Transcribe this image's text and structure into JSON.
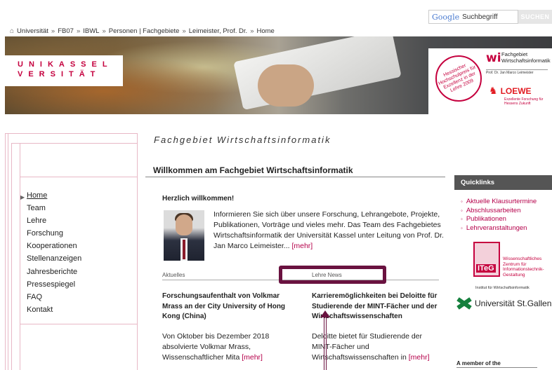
{
  "search": {
    "logo": "Google",
    "placeholder": "Suchbegriff",
    "button": "SUCHEN"
  },
  "breadcrumb": [
    "Universität",
    "FB07",
    "IBWL",
    "Personen | Fachgebiete",
    "Leimeister, Prof. Dr.",
    "Home"
  ],
  "breadcrumb_separator": "»",
  "banner": {
    "uni_line1": "UNIKASSEL",
    "uni_line2": "VERSITÄT",
    "seal_text": "Hessischer Hochschulpreis für Exzellenz in der Lehre 2009",
    "wi_mark": "wi",
    "wi_title": "Fachgebiet\nWirtschaftsinformatik",
    "wi_prof": "Prof. Dr. Jan Marco Leimeister",
    "loewe": "LOEWE",
    "loewe_sub": "Exzellente Forschung für\nHessens Zukunft"
  },
  "nav": {
    "items": [
      "Home",
      "Team",
      "Lehre",
      "Forschung",
      "Kooperationen",
      "Stellenanzeigen",
      "Jahresberichte",
      "Pressespiegel",
      "FAQ",
      "Kontakt"
    ],
    "active": "Home"
  },
  "main": {
    "section_title": "Fachgebiet Wirtschaftsinformatik",
    "welcome_title": "Willkommen am Fachgebiet Wirtschaftsinformatik",
    "greeting": "Herzlich willkommen!",
    "intro": "Informieren Sie sich über unsere Forschung, Lehrangebote, Projekte, Publikationen, Vorträge und vieles mehr. Das Team des Fachgebietes Wirtschaftsinformatik der Universität Kassel unter Leitung von Prof. Dr. Jan Marco Leimeister...",
    "more": "[mehr]",
    "tabs": [
      "Aktuelles",
      "Lehre News"
    ],
    "news_left": {
      "title": "Forschungsaufenthalt von Volkmar Mrass an der City University of Hong Kong (China)",
      "body": "Von Oktober bis Dezember 2018 absolvierte Volkmar Mrass, Wissenschaftlicher Mita",
      "more": "[mehr]"
    },
    "news_right": {
      "title": "Karrieremöglichkeiten bei Deloitte für Studierende der MINT-Fächer und der Wirtschaftswissenschaften",
      "body": "Deloitte bietet für Studierende der MINT-Fächer und Wirtschaftswissenschaften in",
      "more": "[mehr]"
    }
  },
  "sidebar": {
    "quicklinks_title": "Quicklinks",
    "quicklinks": [
      "Aktuelle Klausurtermine",
      "Abschlussarbeiten",
      "Publikationen",
      "Lehrveranstaltungen"
    ],
    "iteg_mark": "ITeG",
    "iteg_text": "Wissenschaftliches\nZentrum für\nInformationstechnik-\nGestaltung",
    "iteg_sub": "Institut für Wirtschaftsinformatik",
    "hsg_name": "Universität St.Gallen",
    "member_label": "A member of the"
  },
  "colors": {
    "accent": "#b5004a",
    "uni_red": "#c5003e",
    "highlight": "#6a1240",
    "ql_header": "#555555"
  }
}
